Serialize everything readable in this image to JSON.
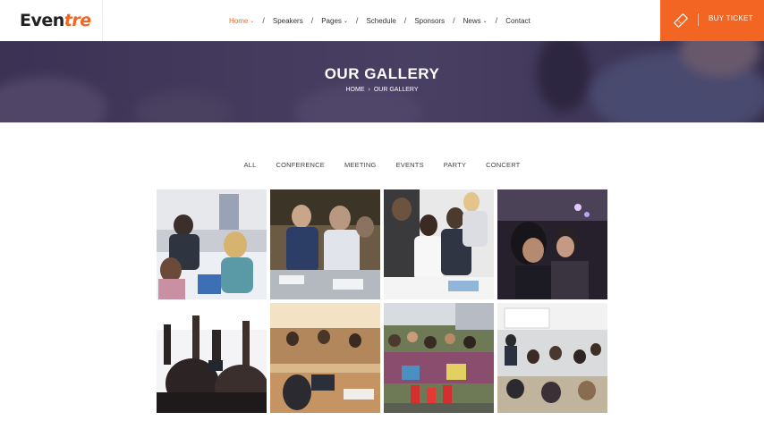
{
  "brand": {
    "logo_main": "Even",
    "logo_accent": "tre"
  },
  "nav": {
    "items": [
      {
        "label": "Home",
        "dropdown": true,
        "active": true
      },
      {
        "label": "Speakers",
        "dropdown": false
      },
      {
        "label": "Pages",
        "dropdown": true
      },
      {
        "label": "Schedule",
        "dropdown": false
      },
      {
        "label": "Sponsors",
        "dropdown": false
      },
      {
        "label": "News",
        "dropdown": true
      },
      {
        "label": "Contact",
        "dropdown": false
      }
    ],
    "separator": "/"
  },
  "buy_ticket": {
    "label": "BUY TICKET",
    "icon": "ticket-icon"
  },
  "banner": {
    "title": "OUR GALLERY",
    "breadcrumb": {
      "home": "HOME",
      "separator": "›",
      "current": "OUR GALLERY"
    }
  },
  "filters": [
    "ALL",
    "CONFERENCE",
    "MEETING",
    "EVENTS",
    "PARTY",
    "CONCERT"
  ],
  "gallery": {
    "photos": [
      {
        "name": "conference-discussion-photo"
      },
      {
        "name": "meeting-table-photo"
      },
      {
        "name": "business-team-photo"
      },
      {
        "name": "evening-party-photo"
      },
      {
        "name": "concert-crowd-photo"
      },
      {
        "name": "classroom-workshop-photo"
      },
      {
        "name": "outdoor-event-crowd-photo"
      },
      {
        "name": "seminar-hall-photo"
      }
    ]
  },
  "colors": {
    "accent": "#f26522",
    "banner_overlay": "#3a3058"
  }
}
